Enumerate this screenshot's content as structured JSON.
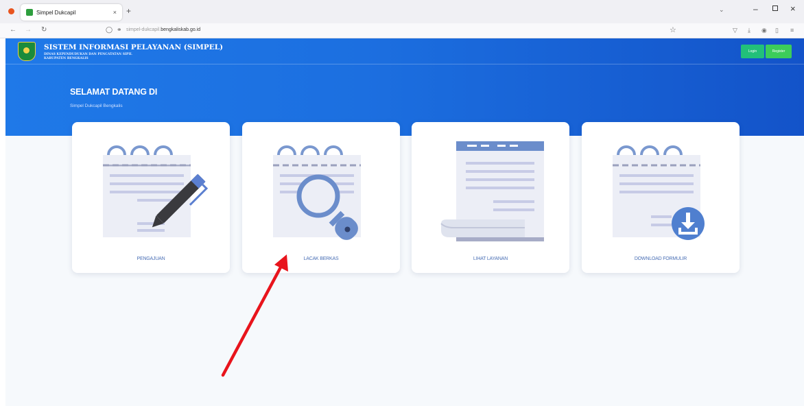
{
  "browser": {
    "tab_title": "Simpel Dukcapil",
    "tab_close": "×",
    "new_tab": "+",
    "url_prefix": "simpel-dukcapil.",
    "url_domain": "bengkaliskab.go.id"
  },
  "header": {
    "brand_title": "SISTEM INFORMASI PELAYANAN (SIMPEL)",
    "brand_sub_line1": "DINAS KEPENDUDUKAN DAN PENCATATAN SIPIL",
    "brand_sub_line2": "KABUPATEN BENGKALIS",
    "login_label": "Login",
    "register_label": "Register"
  },
  "hero": {
    "title": "SELAMAT DATANG DI",
    "subtitle": "Simpel Dukcapil Bengkalis"
  },
  "cards": [
    {
      "label": "PENGAJUAN",
      "icon": "notepad-pen-icon"
    },
    {
      "label": "LACAK BERKAS",
      "icon": "notepad-magnifier-icon"
    },
    {
      "label": "LIHAT LAYANAN",
      "icon": "document-scroll-icon"
    },
    {
      "label": "DOWNLOAD FORMULIR",
      "icon": "notepad-download-icon"
    }
  ],
  "colors": {
    "hero_start": "#1f79e8",
    "hero_end": "#1353c9",
    "login_button": "#22c07a",
    "register_button": "#3ccd5a",
    "card_label": "#4a6fb5",
    "annotation_arrow": "#e8141c"
  }
}
